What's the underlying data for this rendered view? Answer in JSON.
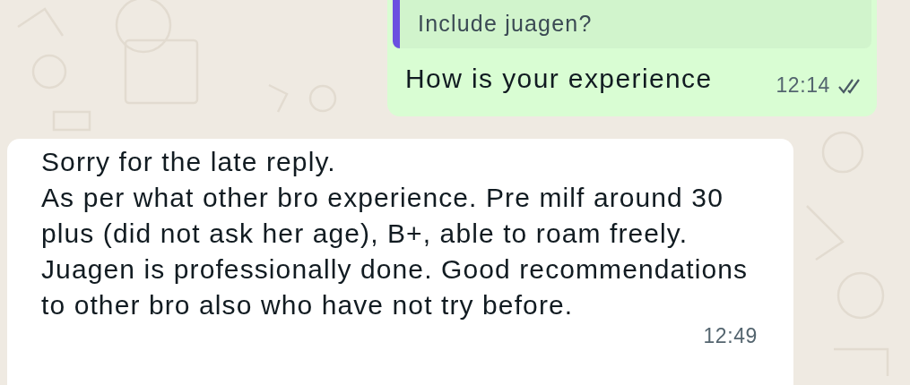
{
  "messages": [
    {
      "kind": "outgoing",
      "quote": {
        "text": "Include juagen?"
      },
      "text": "How is your experience",
      "time": "12:14",
      "read": false
    },
    {
      "kind": "incoming",
      "text": "Sorry for the late reply.\nAs per what other bro experience. Pre milf around 30 plus (did not ask her age), B+, able to roam freely. Juagen is professionally done. Good recommendations to other bro also who have not try before.",
      "time": "12:49"
    }
  ]
}
